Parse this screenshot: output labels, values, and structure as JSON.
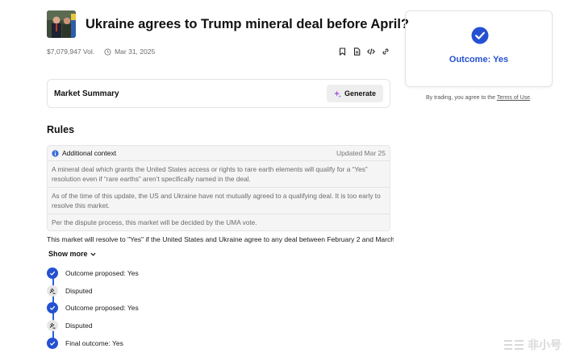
{
  "market": {
    "title": "Ukraine agrees to Trump mineral deal before April?",
    "volume": "$7,079,947 Vol.",
    "date": "Mar 31, 2025"
  },
  "summary": {
    "label": "Market Summary",
    "generate_label": "Generate"
  },
  "rules": {
    "heading": "Rules",
    "context": {
      "title": "Additional context",
      "updated": "Updated Mar 25",
      "paragraphs": [
        "A mineral deal which grants the United States access or rights to rare earth elements will qualify for a “Yes” resolution even if “rare earths” aren’t specifically named in the deal.",
        "As of the time of this update, the US and Ukraine have not mutually agreed to a qualifying deal. It is too early to resolve this market.",
        "Per the dispute process, this market will be decided by the UMA vote."
      ]
    },
    "description": "This market will resolve to \"Yes\" if the United States and Ukraine agree to any deal between February 2 and March",
    "show_more": "Show more"
  },
  "timeline": [
    {
      "label": "Outcome proposed: Yes",
      "status": "check"
    },
    {
      "label": "Disputed",
      "status": "dispute"
    },
    {
      "label": "Outcome proposed: Yes",
      "status": "check"
    },
    {
      "label": "Disputed",
      "status": "dispute"
    },
    {
      "label": "Final outcome: Yes",
      "status": "check"
    }
  ],
  "outcome": {
    "label": "Outcome: Yes",
    "icon": "check-circle-icon",
    "color": "#2451d2"
  },
  "terms": {
    "prefix": "By trading, you agree to the ",
    "link": "Terms of Use",
    "suffix": "."
  },
  "watermark": {
    "text": "非小号"
  },
  "colors": {
    "accent": "#2451d2",
    "muted": "#6b6b6b"
  }
}
